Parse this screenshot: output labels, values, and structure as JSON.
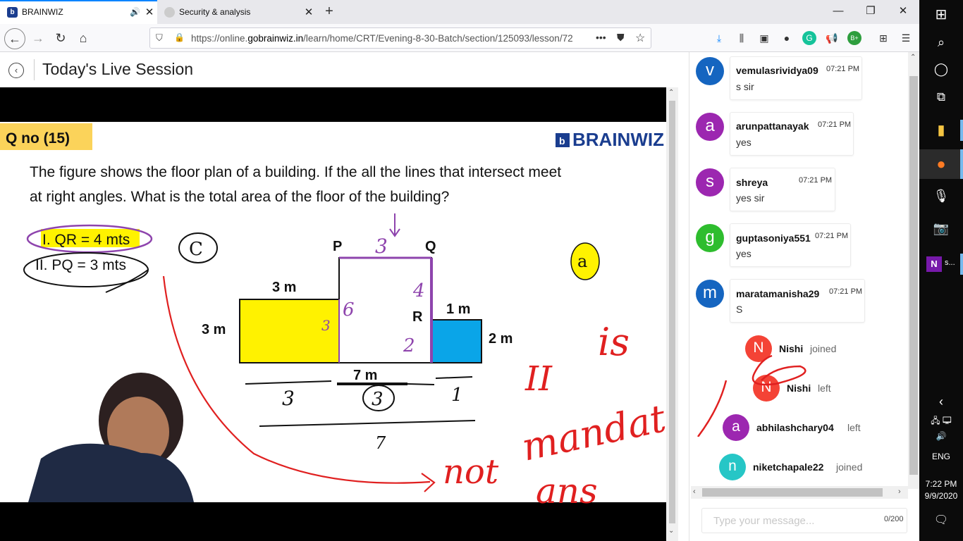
{
  "browser": {
    "tabs": [
      {
        "title": "BRAINWIZ",
        "favicon": "brainwiz-favicon",
        "active": true
      },
      {
        "title": "Security & analysis",
        "favicon": "github-favicon",
        "active": false
      }
    ],
    "url_prefix": "https://online.",
    "url_domain": "gobrainwiz.in",
    "url_path": "/learn/home/CRT/Evening-8-30-Batch/section/125093/lesson/72",
    "url_more": "•••"
  },
  "session": {
    "title": "Today's Live Session"
  },
  "slide": {
    "question_no": "Q no (15)",
    "brand": "BRAINWIZ",
    "question_line1": "The figure shows the floor plan of a building. If the all the lines that intersect meet",
    "question_line2": "at right angles. What is the total area of the floor of the building?",
    "stmt1": "I. QR = 4 mts",
    "stmt2": "II. PQ = 3 mts",
    "label_P": "P",
    "label_Q": "Q",
    "label_R": "R",
    "label_3m_top": "3 m",
    "label_3m_left": "3 m",
    "label_1m": "1 m",
    "label_2m": "2 m",
    "label_7m": "7 m",
    "hand_c": "C",
    "hand_a": "a",
    "hand_3_top": "3",
    "hand_4": "4",
    "hand_6": "6",
    "hand_3_mid": "3",
    "hand_2": "2",
    "hand_3_bottom": "3",
    "hand_3_circled": "3",
    "hand_1": "1",
    "hand_7": "7",
    "hand_roman": "II",
    "hand_is": "is",
    "hand_not": "not",
    "hand_mandatory": "mandatory",
    "hand_ans": "ans"
  },
  "chat": {
    "messages": [
      {
        "initial": "v",
        "color": "#1565c0",
        "name": "vemulasrividya09",
        "time": "07:21 PM",
        "text": "s sir"
      },
      {
        "initial": "a",
        "color": "#9c27b0",
        "name": "arunpattanayak",
        "time": "07:21 PM",
        "text": "yes"
      },
      {
        "initial": "s",
        "color": "#9c27b0",
        "name": "shreya",
        "time": "07:21 PM",
        "text": "yes sir"
      },
      {
        "initial": "g",
        "color": "#2ebd2e",
        "name": "guptasoniya551",
        "time": "07:21 PM",
        "text": "yes"
      },
      {
        "initial": "m",
        "color": "#1565c0",
        "name": "maratamanisha29",
        "time": "07:21 PM",
        "text": "S"
      }
    ],
    "events": [
      {
        "initial": "N",
        "color": "#f44336",
        "name": "Nishi",
        "status": "joined"
      },
      {
        "initial": "N",
        "color": "#f44336",
        "name": "Nishi",
        "status": "left"
      },
      {
        "initial": "a",
        "color": "#9c27b0",
        "name": "abhilashchary04",
        "status": "left"
      },
      {
        "initial": "n",
        "color": "#26c6c6",
        "name": "niketchapale22",
        "status": "joined"
      }
    ],
    "input_placeholder": "Type your message...",
    "char_count": "0/200"
  },
  "taskbar": {
    "onenote_label": "s...",
    "language": "ENG",
    "time": "7:22 PM",
    "date": "9/9/2020"
  }
}
